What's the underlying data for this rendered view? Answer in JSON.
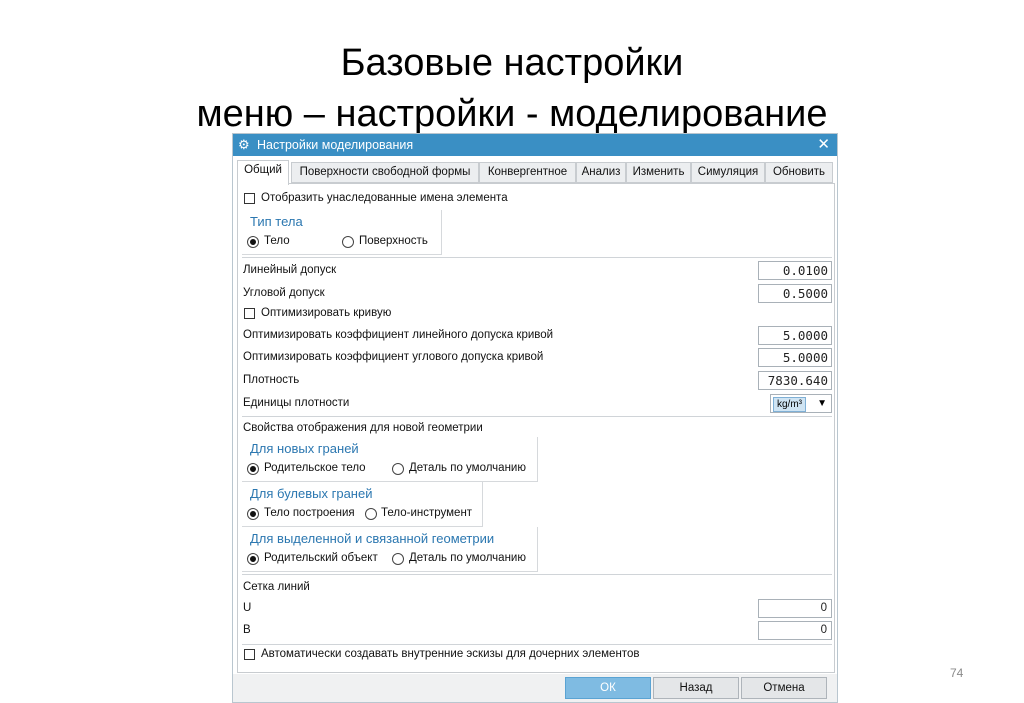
{
  "slide": {
    "title_line1": "Базовые настройки",
    "title_line2": "меню – настройки - моделирование",
    "page_number": "74"
  },
  "dialog": {
    "title": "Настройки моделирования",
    "close_glyph": "✕",
    "icon": "gear-icon",
    "tabs": [
      "Общий",
      "Поверхности свободной формы",
      "Конвергентное",
      "Анализ",
      "Изменить",
      "Симуляция",
      "Обновить"
    ],
    "active_tab": "Общий",
    "show_inherited_names": "Отобразить унаследованные имена элемента",
    "body_type": {
      "title": "Тип тела",
      "options": [
        "Тело",
        "Поверхность"
      ],
      "selected": "Тело"
    },
    "linear_tolerance": {
      "label": "Линейный допуск",
      "value": "0.0100"
    },
    "angular_tolerance": {
      "label": "Угловой допуск",
      "value": "0.5000"
    },
    "optimize_curve": "Оптимизировать кривую",
    "opt_linear_coeff": {
      "label": "Оптимизировать коэффициент линейного допуска кривой",
      "value": "5.0000"
    },
    "opt_angular_coeff": {
      "label": "Оптимизировать коэффициент углового допуска кривой",
      "value": "5.0000"
    },
    "density": {
      "label": "Плотность",
      "value": "7830.640"
    },
    "density_units": {
      "label": "Единицы плотности",
      "value": "kg/m³"
    },
    "display_props": {
      "title": "Свойства отображения для новой геометрии",
      "new_faces": {
        "title": "Для новых граней",
        "options": [
          "Родительское тело",
          "Деталь по умолчанию"
        ],
        "selected": "Родительское тело"
      },
      "boolean_faces": {
        "title": "Для булевых граней",
        "options": [
          "Тело построения",
          "Тело-инструмент"
        ],
        "selected": "Тело построения"
      },
      "extracted_geom": {
        "title": "Для выделенной и связанной геометрии",
        "options": [
          "Родительский объект",
          "Деталь по умолчанию"
        ],
        "selected": "Родительский объект"
      }
    },
    "grid": {
      "title": "Сетка линий",
      "u_label": "U",
      "u_value": "0",
      "v_label": "B",
      "v_value": "0"
    },
    "auto_sketches": "Автоматически создавать внутренние эскизы для дочерних элементов",
    "buttons": {
      "ok": "ОК",
      "back": "Назад",
      "cancel": "Отмена"
    },
    "colors": {
      "titlebar": "#3a8fc4",
      "group_title": "#2b77b0",
      "ok_button": "#7fbbe2"
    }
  }
}
